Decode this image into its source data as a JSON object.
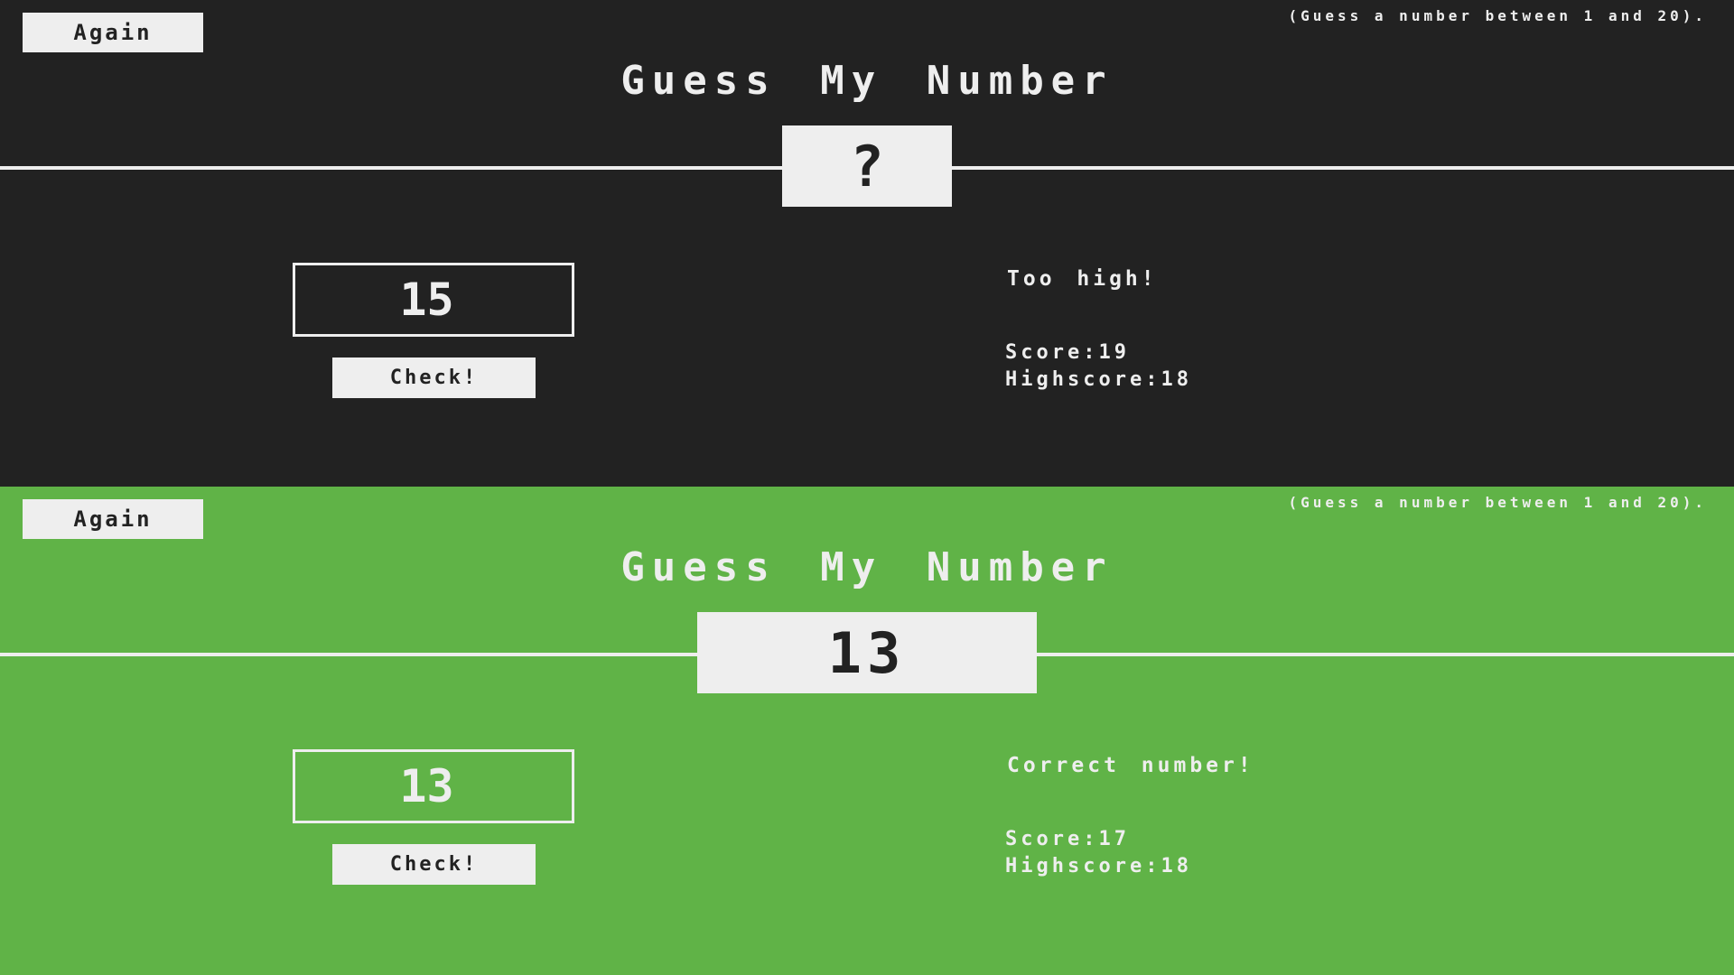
{
  "screens": [
    {
      "state": "playing",
      "background": "#222222",
      "again_label": "Again",
      "hint": "(Guess a number between 1 and 20).",
      "title": "Guess My Number",
      "secret_display": "?",
      "guess_value": "15",
      "check_label": "Check!",
      "message": "Too high!",
      "score_label": "Score:",
      "score_value": "19",
      "highscore_label": "Highscore:",
      "highscore_value": "18"
    },
    {
      "state": "won",
      "background": "#60b347",
      "again_label": "Again",
      "hint": "(Guess a number between 1 and 20).",
      "title": "Guess My Number",
      "secret_display": "13",
      "guess_value": "13",
      "check_label": "Check!",
      "message": "Correct number!",
      "score_label": "Score:",
      "score_value": "17",
      "highscore_label": "Highscore:",
      "highscore_value": "18"
    }
  ],
  "colors": {
    "text": "#eeeeee",
    "dark_text": "#222222"
  }
}
